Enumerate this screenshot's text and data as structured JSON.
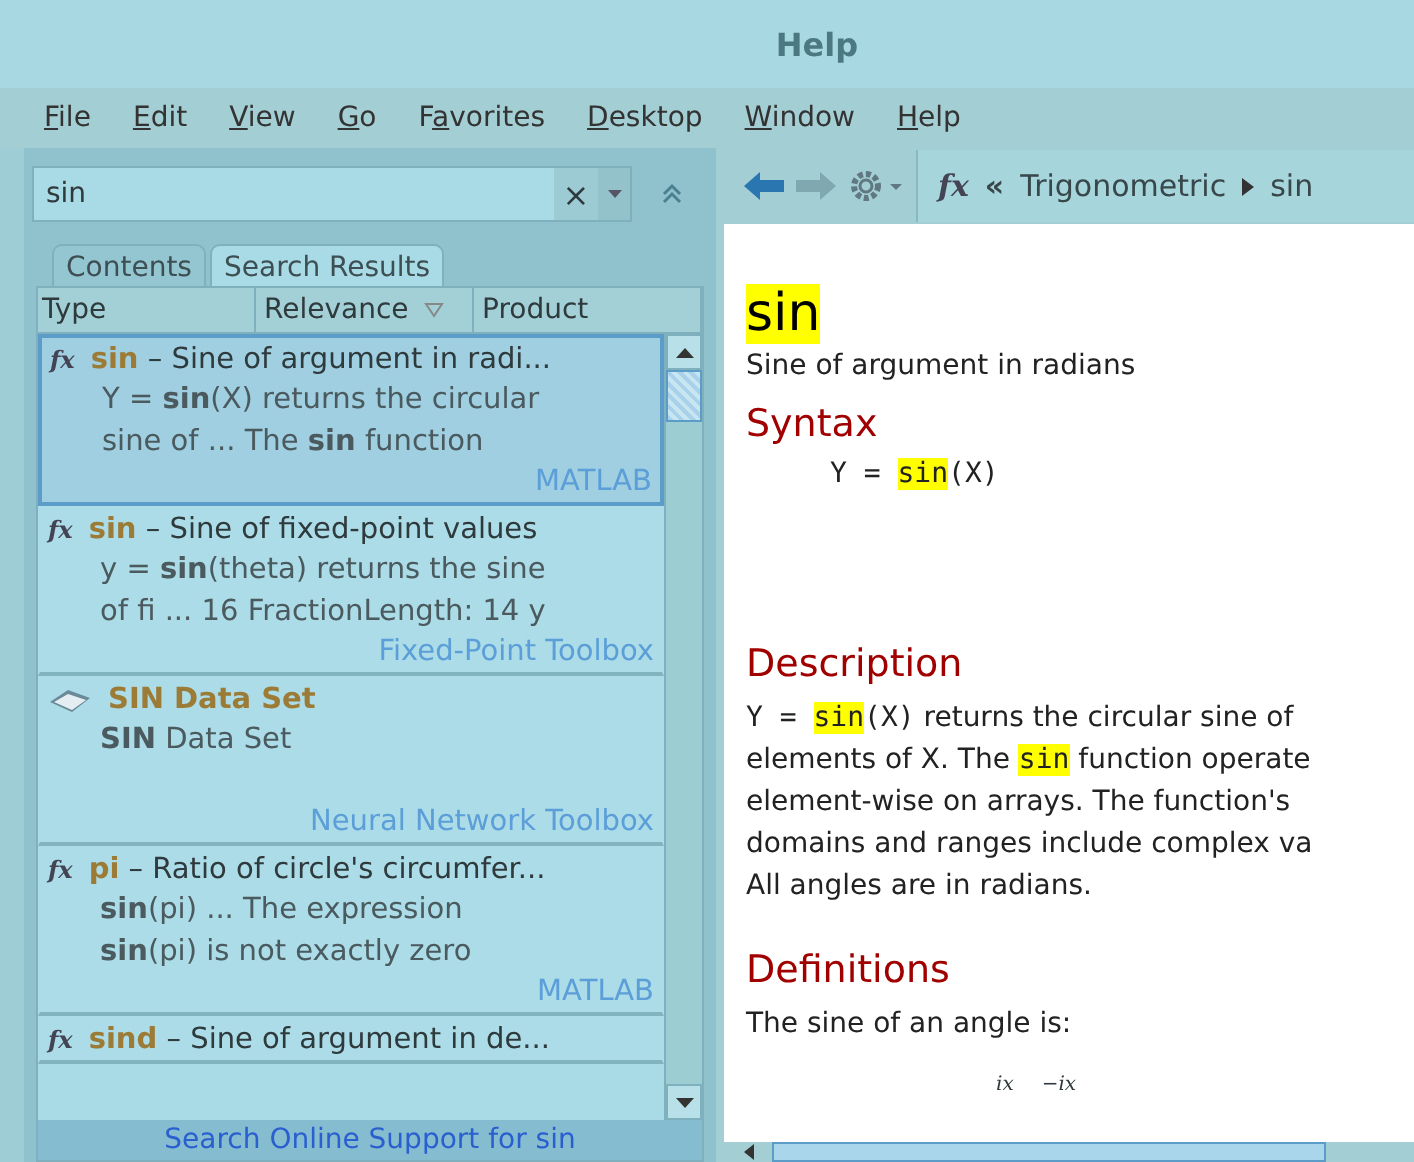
{
  "window": {
    "title": "Help"
  },
  "menu": [
    {
      "key": "F",
      "after": "ile"
    },
    {
      "key": "E",
      "after": "dit"
    },
    {
      "key": "V",
      "after": "iew"
    },
    {
      "key": "G",
      "after": "o"
    },
    {
      "before": "F",
      "key": "a",
      "after": "vorites"
    },
    {
      "key": "D",
      "after": "esktop"
    },
    {
      "key": "W",
      "after": "indow"
    },
    {
      "key": "H",
      "after": "elp"
    }
  ],
  "search": {
    "value": "sin",
    "clear": "×"
  },
  "tabs": [
    {
      "label": "Contents",
      "selected": false
    },
    {
      "label": "Search Results",
      "selected": true
    }
  ],
  "columns": [
    "Type",
    "Relevance",
    "Product"
  ],
  "results": [
    {
      "kind": "function",
      "type_label": "fx",
      "name": "sin",
      "title": " – Sine of argument in radi...",
      "lines": [
        "Y = **sin**(X) returns the circular",
        "sine of ... The **sin** function"
      ],
      "product": "MATLAB",
      "selected": true
    },
    {
      "kind": "function",
      "type_label": "fx",
      "name": "sin",
      "title": " – Sine of fixed-point values",
      "lines": [
        "y = **sin**(theta) returns the sine",
        "of fi ... 16 FractionLength: 14 y"
      ],
      "product": "Fixed-Point Toolbox",
      "selected": false
    },
    {
      "kind": "dataset",
      "name": "SIN Data Set",
      "lines": [
        "**SIN** Data Set"
      ],
      "product": "Neural Network Toolbox",
      "selected": false
    },
    {
      "kind": "function",
      "type_label": "fx",
      "name": "pi",
      "title": " – Ratio of circle's circumfer...",
      "lines": [
        "**sin**(pi) ... The expression",
        "**sin**(pi) is not exactly zero"
      ],
      "product": "MATLAB",
      "selected": false
    },
    {
      "kind": "function",
      "type_label": "fx",
      "name": "sind",
      "title": " – Sine of argument in de...",
      "selected": false
    }
  ],
  "online_link": "Search Online Support for sin",
  "breadcrumb": {
    "type_label": "fx",
    "back": "«",
    "parent": "Trigonometric",
    "current": "sin"
  },
  "page": {
    "title": "sin",
    "summary": "Sine of argument in radians",
    "sections": [
      {
        "heading": "Syntax",
        "kind": "code",
        "lines": [
          [
            {
              "text": "Y = ",
              "hl": false
            },
            {
              "text": "sin",
              "hl": true
            },
            {
              "text": "(X)",
              "hl": false
            }
          ]
        ]
      },
      {
        "heading": "Description",
        "kind": "text",
        "lines": [
          [
            {
              "text": "Y = ",
              "hl": false,
              "code": true
            },
            {
              "text": "sin",
              "hl": true,
              "code": true
            },
            {
              "text": "(X)",
              "hl": false,
              "code": true
            },
            {
              "text": " returns the circular sine of",
              "hl": false,
              "code": false
            }
          ],
          [
            {
              "text": "elements of X. The ",
              "hl": false,
              "code": false
            },
            {
              "text": "sin",
              "hl": true,
              "code": true
            },
            {
              "text": " function operate",
              "hl": false,
              "code": false
            }
          ],
          [
            {
              "text": "element-wise on arrays. The function's",
              "hl": false,
              "code": false
            }
          ],
          [
            {
              "text": "domains and ranges include complex va",
              "hl": false,
              "code": false
            }
          ],
          [
            {
              "text": "All angles are in radians.",
              "hl": false,
              "code": false
            }
          ]
        ]
      },
      {
        "heading": "Definitions",
        "kind": "text",
        "lines": [
          [
            {
              "text": "The sine of an angle is:",
              "hl": false,
              "code": false
            }
          ]
        ]
      }
    ],
    "formula_fragments": [
      "ix",
      "−ix"
    ]
  }
}
